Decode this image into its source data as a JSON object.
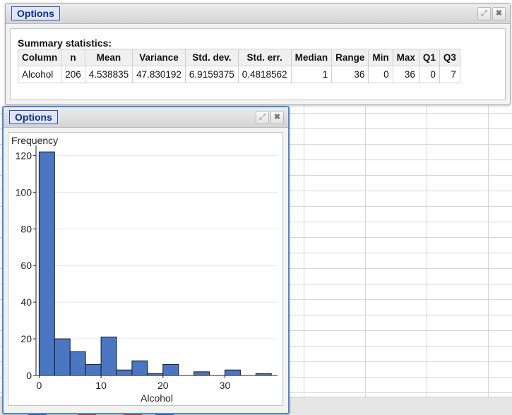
{
  "stats_panel": {
    "options_label": "Options",
    "title": "Summary statistics:",
    "columns": [
      "Column",
      "n",
      "Mean",
      "Variance",
      "Std. dev.",
      "Std. err.",
      "Median",
      "Range",
      "Min",
      "Max",
      "Q1",
      "Q3"
    ],
    "rows": [
      [
        "Alcohol",
        "206",
        "4.538835",
        "47.830192",
        "6.9159375",
        "0.4818562",
        "1",
        "36",
        "0",
        "36",
        "0",
        "7"
      ]
    ]
  },
  "hist_panel": {
    "options_label": "Options",
    "menu_icon": "hamburger-menu-icon"
  },
  "window_icons": {
    "maximize": "expand-icon",
    "close": "close-icon"
  },
  "colors": {
    "bar_fill": "#4a77c4",
    "bar_stroke": "#1a1a1a",
    "options_text": "#0d2d9a",
    "active_border": "#4a86d8"
  },
  "chart_data": {
    "type": "bar",
    "xlabel": "Alcohol",
    "ylabel": "Frequency",
    "xlim": [
      -0.5,
      38.5
    ],
    "ylim": [
      0,
      124
    ],
    "x_ticks": [
      0,
      10,
      20,
      30
    ],
    "y_ticks": [
      0,
      20,
      40,
      60,
      80,
      100,
      120
    ],
    "bin_width": 2.5,
    "bins": [
      {
        "start": 0.0,
        "count": 122
      },
      {
        "start": 2.5,
        "count": 20
      },
      {
        "start": 5.0,
        "count": 13
      },
      {
        "start": 7.5,
        "count": 6
      },
      {
        "start": 10.0,
        "count": 21
      },
      {
        "start": 12.5,
        "count": 3
      },
      {
        "start": 15.0,
        "count": 8
      },
      {
        "start": 17.5,
        "count": 1
      },
      {
        "start": 20.0,
        "count": 6
      },
      {
        "start": 25.0,
        "count": 2
      },
      {
        "start": 30.0,
        "count": 3
      },
      {
        "start": 35.0,
        "count": 1
      }
    ],
    "grid": true
  }
}
